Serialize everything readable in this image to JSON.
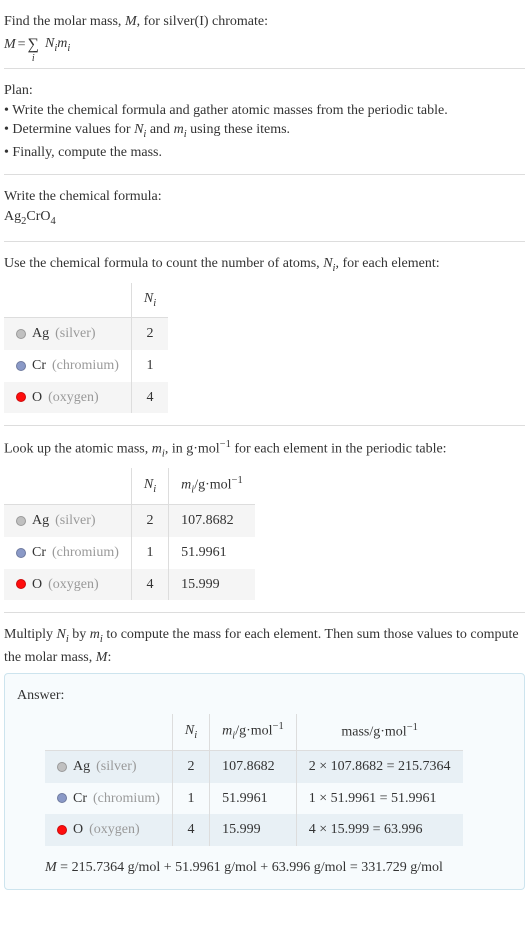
{
  "intro": {
    "line1": "Find the molar mass, ",
    "line1_var": "M",
    "line1_end": ", for silver(I) chromate:",
    "eq_lhs": "M",
    "eq_eq": " = ",
    "eq_sum": "∑",
    "eq_sub": "i",
    "eq_rhs1": "N",
    "eq_rhs1_sub": "i",
    "eq_rhs2": "m",
    "eq_rhs2_sub": "i"
  },
  "plan": {
    "title": "Plan:",
    "b1": "• Write the chemical formula and gather atomic masses from the periodic table.",
    "b2_a": "• Determine values for ",
    "b2_n": "N",
    "b2_ni": "i",
    "b2_and": " and ",
    "b2_m": "m",
    "b2_mi": "i",
    "b2_end": " using these items.",
    "b3": "• Finally, compute the mass."
  },
  "formula_section": {
    "title": "Write the chemical formula:",
    "ag": "Ag",
    "ag_sub": "2",
    "cr": "CrO",
    "o_sub": "4"
  },
  "count_section": {
    "intro_a": "Use the chemical formula to count the number of atoms, ",
    "intro_n": "N",
    "intro_ni": "i",
    "intro_end": ", for each element:",
    "header_n": "N",
    "header_ni": "i",
    "rows": [
      {
        "sym": "Ag",
        "name": "(silver)",
        "dot": "dot-ag",
        "n": "2"
      },
      {
        "sym": "Cr",
        "name": "(chromium)",
        "dot": "dot-cr",
        "n": "1"
      },
      {
        "sym": "O",
        "name": "(oxygen)",
        "dot": "dot-o",
        "n": "4"
      }
    ]
  },
  "mass_section": {
    "intro_a": "Look up the atomic mass, ",
    "intro_m": "m",
    "intro_mi": "i",
    "intro_mid": ", in g·mol",
    "intro_exp": "−1",
    "intro_end": " for each element in the periodic table:",
    "header_n": "N",
    "header_ni": "i",
    "header_m": "m",
    "header_mi": "i",
    "header_unit": "/g·mol",
    "header_exp": "−1",
    "rows": [
      {
        "sym": "Ag",
        "name": "(silver)",
        "dot": "dot-ag",
        "n": "2",
        "m": "107.8682"
      },
      {
        "sym": "Cr",
        "name": "(chromium)",
        "dot": "dot-cr",
        "n": "1",
        "m": "51.9961"
      },
      {
        "sym": "O",
        "name": "(oxygen)",
        "dot": "dot-o",
        "n": "4",
        "m": "15.999"
      }
    ]
  },
  "multiply_section": {
    "intro_a": "Multiply ",
    "intro_n": "N",
    "intro_ni": "i",
    "intro_by": " by ",
    "intro_m": "m",
    "intro_mi": "i",
    "intro_mid": " to compute the mass for each element. Then sum those values to compute the molar mass, ",
    "intro_M": "M",
    "intro_end": ":"
  },
  "answer": {
    "title": "Answer:",
    "header_n": "N",
    "header_ni": "i",
    "header_m": "m",
    "header_mi": "i",
    "header_unit": "/g·mol",
    "header_exp": "−1",
    "header_mass": "mass/g·mol",
    "header_mass_exp": "−1",
    "rows": [
      {
        "sym": "Ag",
        "name": "(silver)",
        "dot": "dot-ag",
        "n": "2",
        "m": "107.8682",
        "calc": "2 × 107.8682 = 215.7364"
      },
      {
        "sym": "Cr",
        "name": "(chromium)",
        "dot": "dot-cr",
        "n": "1",
        "m": "51.9961",
        "calc": "1 × 51.9961 = 51.9961"
      },
      {
        "sym": "O",
        "name": "(oxygen)",
        "dot": "dot-o",
        "n": "4",
        "m": "15.999",
        "calc": "4 × 15.999 = 63.996"
      }
    ],
    "final_m": "M",
    "final_eq": " = 215.7364 g/mol + 51.9961 g/mol + 63.996 g/mol = 331.729 g/mol"
  }
}
